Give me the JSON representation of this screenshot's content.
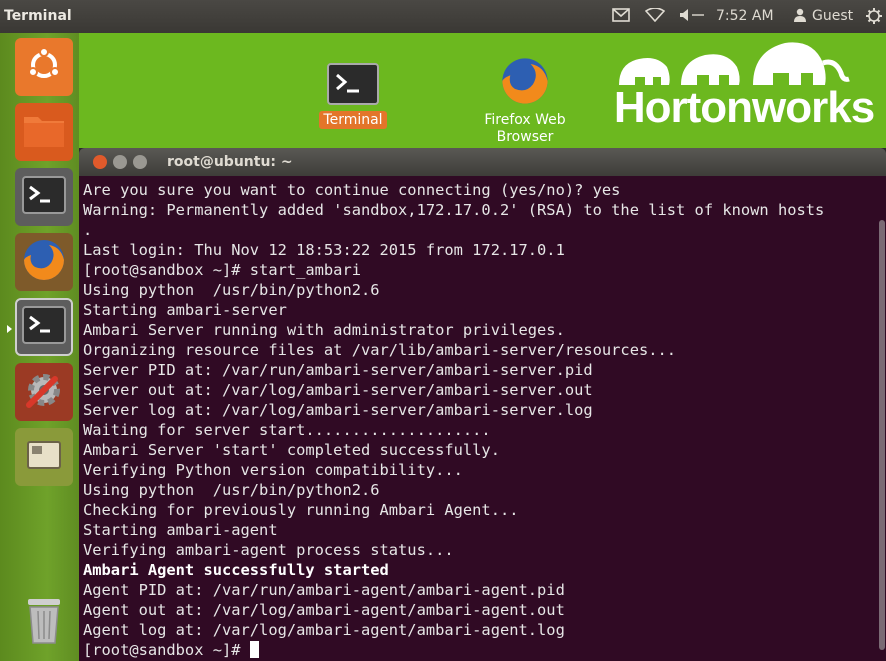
{
  "topbar": {
    "title": "Terminal",
    "time": "7:52 AM",
    "user": "Guest",
    "icons": [
      "mail-icon",
      "wifi-icon",
      "volume-icon",
      "person-icon",
      "power-icon"
    ]
  },
  "launcher": {
    "items": [
      "ubuntu-dash",
      "files",
      "terminal",
      "firefox",
      "terminal-active",
      "system-settings",
      "workspaces",
      "trash"
    ]
  },
  "desktop": {
    "icons": [
      {
        "label": "Terminal"
      },
      {
        "label_line1": "Firefox Web",
        "label_line2": "Browser"
      }
    ],
    "logo_text": "Hortonworks"
  },
  "window": {
    "title": "root@ubuntu: ~"
  },
  "terminal": {
    "lines": [
      "Are you sure you want to continue connecting (yes/no)? yes",
      "Warning: Permanently added 'sandbox,172.17.0.2' (RSA) to the list of known hosts",
      ".",
      "Last login: Thu Nov 12 18:53:22 2015 from 172.17.0.1",
      "[root@sandbox ~]# start_ambari",
      "Using python  /usr/bin/python2.6",
      "Starting ambari-server",
      "Ambari Server running with administrator privileges.",
      "Organizing resource files at /var/lib/ambari-server/resources...",
      "Server PID at: /var/run/ambari-server/ambari-server.pid",
      "Server out at: /var/log/ambari-server/ambari-server.out",
      "Server log at: /var/log/ambari-server/ambari-server.log",
      "Waiting for server start....................",
      "Ambari Server 'start' completed successfully.",
      "Verifying Python version compatibility...",
      "Using python  /usr/bin/python2.6",
      "Checking for previously running Ambari Agent...",
      "Starting ambari-agent",
      "Verifying ambari-agent process status...",
      "Ambari Agent successfully started",
      "Agent PID at: /var/run/ambari-agent/ambari-agent.pid",
      "Agent out at: /var/log/ambari-agent/ambari-agent.out",
      "Agent log at: /var/log/ambari-agent/ambari-agent.log"
    ],
    "prompt": "[root@sandbox ~]# "
  },
  "colors": {
    "terminal_bg": "#300a24",
    "desktop_green": "#6cb81f",
    "launcher_green": "#6fa22a",
    "close_button": "#e05a2b"
  }
}
